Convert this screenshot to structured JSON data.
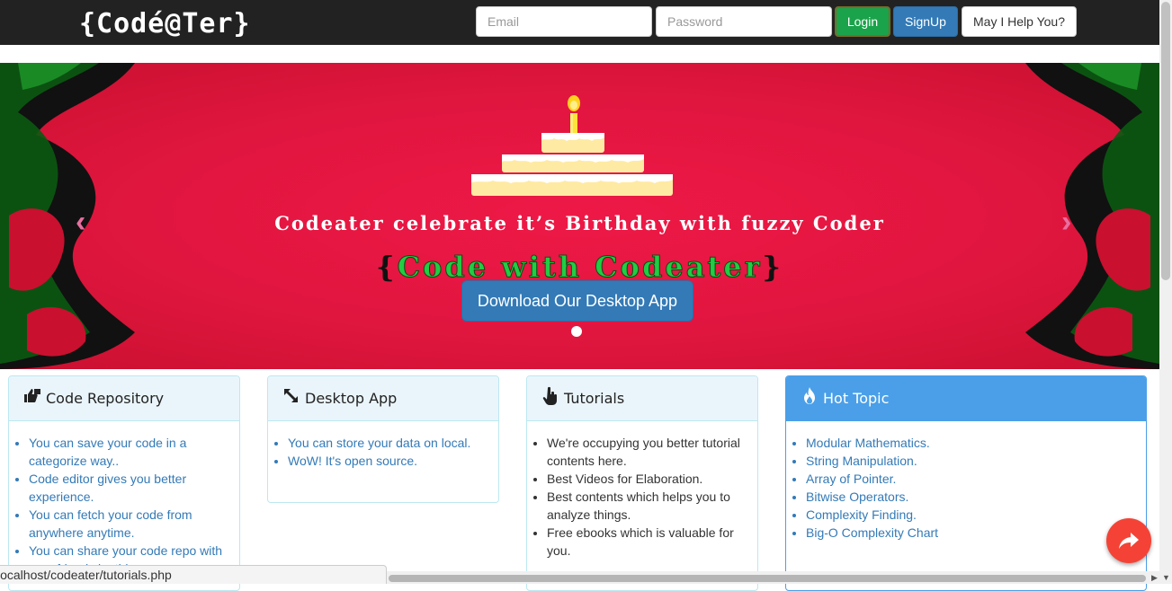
{
  "brand": {
    "logo_text": "{Codé@Ter}"
  },
  "auth": {
    "email_placeholder": "Email",
    "password_placeholder": "Password",
    "login_label": "Login",
    "signup_label": "SignUp",
    "help_label": "May I Help You?"
  },
  "carousel": {
    "headline": "Codeater celebrate it’s Birthday with fuzzy Coder",
    "tagline": "Code with Codeater",
    "tagline_open": "{",
    "tagline_close": "}",
    "cta_label": "Download Our Desktop App",
    "prev_glyph": "‹",
    "next_glyph": "›"
  },
  "panels": [
    {
      "title": "Code Repository",
      "icon": "thumbs-icon",
      "items": [
        "You can save your code in a categorize way..",
        "Code editor gives you better experience.",
        "You can fetch your code from anywhere anytime.",
        "You can share your code repo with your friends by this..."
      ]
    },
    {
      "title": "Desktop App",
      "icon": "resize-icon",
      "items": [
        "You can store your data on local.",
        "WoW! It's open source."
      ]
    },
    {
      "title": "Tutorials",
      "icon": "hand-pointer-icon",
      "items": [
        "We're occupying you better tutorial contents here.",
        "Best Videos for Elaboration.",
        "Best contents which helps you to analyze things.",
        "Free ebooks which is valuable for you."
      ]
    },
    {
      "title": "Hot Topic",
      "icon": "fire-icon",
      "items": [
        "Modular Mathematics.",
        "String Manipulation.",
        "Array of Pointer.",
        "Bitwise Operators.",
        "Complexity Finding.",
        "Big-O Complexity Chart"
      ]
    }
  ],
  "status_bar": {
    "url": "localhost/codeater/tutorials.php"
  },
  "colors": {
    "navbar": "#222222",
    "banner": "#e0163f",
    "login": "#1aa34a",
    "primary": "#337ab7",
    "hot_topic": "#4a9fe8",
    "share": "#f44336"
  }
}
